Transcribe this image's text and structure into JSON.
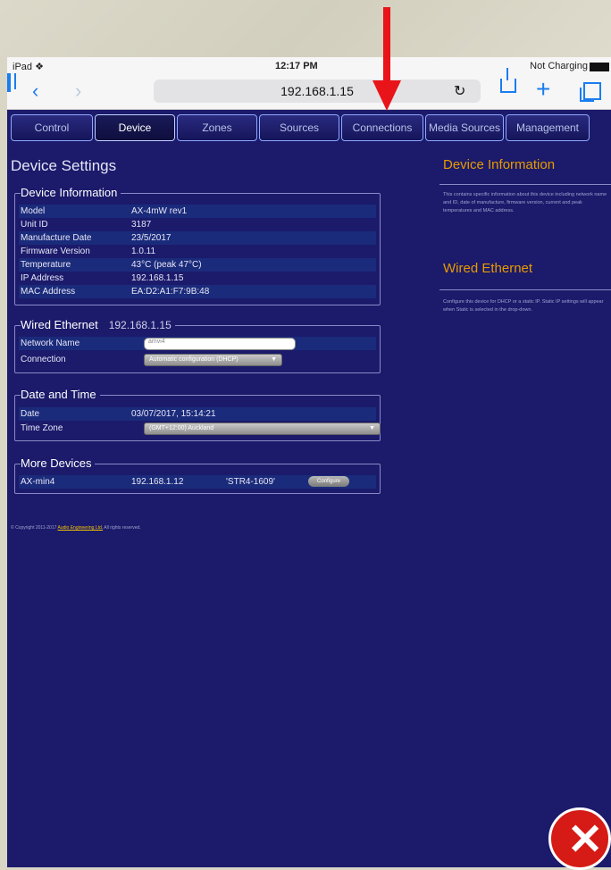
{
  "statusbar": {
    "carrier": "iPad ❖",
    "time": "12:17 PM",
    "battery": "Not Charging"
  },
  "browser": {
    "url": "192.168.1.15",
    "back": "‹",
    "forward": "›",
    "reload": "↻",
    "new_tab": "+"
  },
  "menu": [
    {
      "label": "Control"
    },
    {
      "label": "Device"
    },
    {
      "label": "Zones"
    },
    {
      "label": "Sources"
    },
    {
      "label": "Connections"
    },
    {
      "label": "Media Sources"
    },
    {
      "label": "Management"
    }
  ],
  "active_menu": "Device",
  "page_title": "Device Settings",
  "device_info": {
    "legend": "Device Information",
    "rows": [
      {
        "label": "Model",
        "value": "AX-4mW rev1"
      },
      {
        "label": "Unit ID",
        "value": "3187"
      },
      {
        "label": "Manufacture Date",
        "value": "23/5/2017"
      },
      {
        "label": "Firmware Version",
        "value": "1.0.11"
      },
      {
        "label": "Temperature",
        "value": "43°C (peak 47°C)"
      },
      {
        "label": "IP Address",
        "value": "192.168.1.15"
      },
      {
        "label": "MAC Address",
        "value": "EA:D2:A1:F7:9B:48"
      }
    ]
  },
  "wired": {
    "legend": "Wired Ethernet",
    "ip": "192.168.1.15",
    "network_name_label": "Network Name",
    "network_name_value": "amvi4",
    "connection_label": "Connection",
    "connection_value": "Automatic configuration (DHCP)"
  },
  "datetime": {
    "legend": "Date and Time",
    "date_label": "Date",
    "date_value": "03/07/2017, 15:14:21",
    "tz_label": "Time Zone",
    "tz_value": "(GMT+12:00) Auckland"
  },
  "more_devices": {
    "legend": "More Devices",
    "device_name": "AX-min4",
    "device_ip": "192.168.1.12",
    "device_serial": "'STR4-1609'",
    "configure_label": "Configure"
  },
  "copyright": {
    "prefix": "© Copyright 2011-2017",
    "link": "Audio Engineering Ltd.",
    "suffix": "All rights reserved."
  },
  "sidebar": {
    "device_info_title": "Device Information",
    "device_info_text": "This contains specific information about this device including network name and ID, date of manufacture, firmware version, current and peak temperatures and MAC address.",
    "wired_title": "Wired Ethernet",
    "wired_text": "Configure this device for DHCP or a static IP. Static IP settings will appear when Static is selected in the drop-down."
  },
  "colors": {
    "accent": "#e89b00",
    "annotation_arrow": "#e8141a",
    "page_bg": "#1b1a6b"
  },
  "icons": [
    "back-icon",
    "forward-icon",
    "bookmarks-icon",
    "reload-icon",
    "share-icon",
    "new-tab-icon",
    "tabs-icon",
    "close-icon"
  ]
}
